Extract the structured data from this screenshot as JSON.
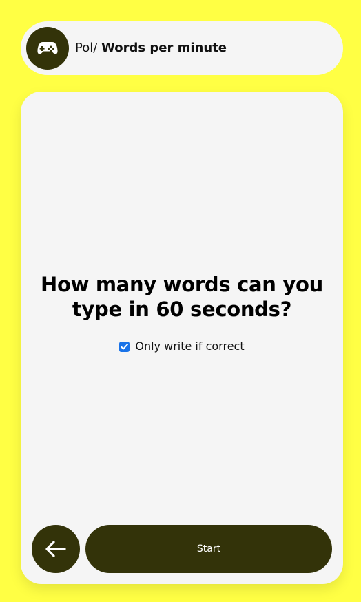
{
  "colors": {
    "background": "#ffff44",
    "card": "#f5f5f5",
    "dark": "#333309",
    "checkbox": "#1a73e8"
  },
  "header": {
    "icon": "gamepad-icon",
    "breadcrumb": "Pol/",
    "title": "Words per minute"
  },
  "main": {
    "question": "How many words can you type in 60 seconds?",
    "option": {
      "label": "Only write if correct",
      "checked": true
    }
  },
  "footer": {
    "back_icon": "arrow-left-icon",
    "start_label": "Start"
  }
}
